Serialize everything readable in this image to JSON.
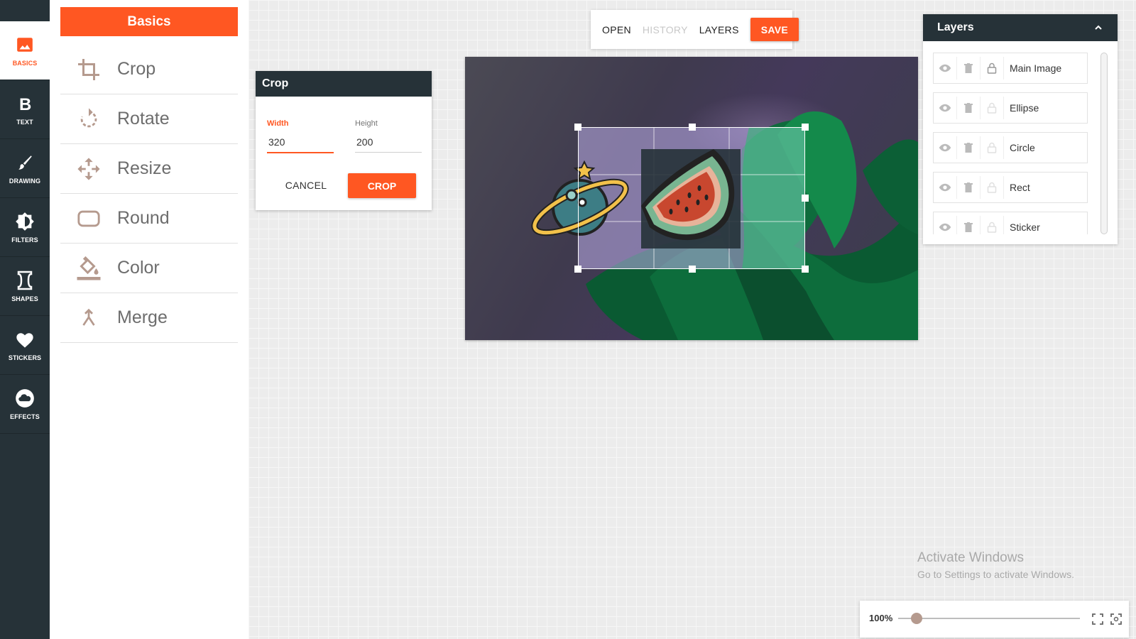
{
  "rail": {
    "items": [
      {
        "label": "BASICS",
        "icon": "image-icon",
        "active": true
      },
      {
        "label": "TEXT",
        "icon": "bold-icon"
      },
      {
        "label": "DRAWING",
        "icon": "brush-icon"
      },
      {
        "label": "FILTERS",
        "icon": "brightness-icon"
      },
      {
        "label": "SHAPES",
        "icon": "shape-icon"
      },
      {
        "label": "STICKERS",
        "icon": "heart-icon"
      },
      {
        "label": "EFFECTS",
        "icon": "cloud-icon"
      }
    ]
  },
  "panel": {
    "title": "Basics",
    "tools": [
      {
        "label": "Crop",
        "icon": "crop-icon"
      },
      {
        "label": "Rotate",
        "icon": "rotate-icon"
      },
      {
        "label": "Resize",
        "icon": "resize-icon"
      },
      {
        "label": "Round",
        "icon": "round-corners-icon"
      },
      {
        "label": "Color",
        "icon": "fill-color-icon"
      },
      {
        "label": "Merge",
        "icon": "merge-icon"
      }
    ]
  },
  "crop": {
    "title": "Crop",
    "width_label": "Width",
    "width_value": "320",
    "height_label": "Height",
    "height_value": "200",
    "cancel_label": "CANCEL",
    "crop_label": "CROP"
  },
  "toolbar": {
    "open": "OPEN",
    "history": "HISTORY",
    "layers": "LAYERS",
    "save": "SAVE"
  },
  "layers": {
    "title": "Layers",
    "items": [
      {
        "name": "Main Image",
        "locked": true
      },
      {
        "name": "Ellipse",
        "locked": false
      },
      {
        "name": "Circle",
        "locked": false
      },
      {
        "name": "Rect",
        "locked": false
      },
      {
        "name": "Sticker",
        "locked": false
      }
    ]
  },
  "watermark": {
    "title": "Activate Windows",
    "subtitle": "Go to Settings to activate Windows."
  },
  "zoom": {
    "value": "100%",
    "level_fraction": 0.1
  },
  "colors": {
    "accent": "#ff5722",
    "dark": "#263238",
    "icon_muted": "#b59a8e"
  }
}
